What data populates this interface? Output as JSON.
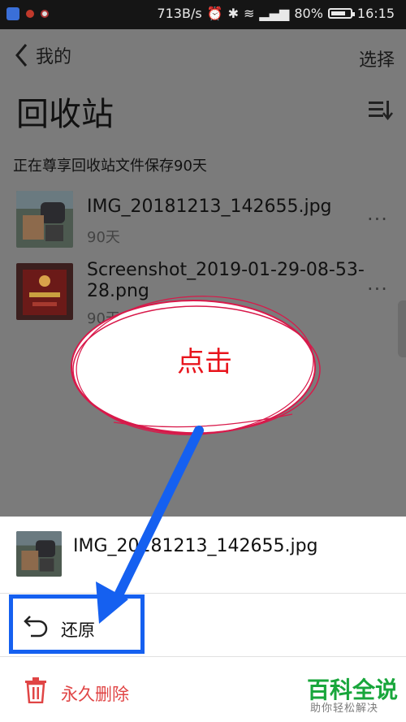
{
  "status_bar": {
    "speed": "713B/s",
    "battery": "80%",
    "battery_level": 0.8,
    "time": "16:15"
  },
  "header": {
    "back_label": "我的",
    "select_label": "选择"
  },
  "page": {
    "title": "回收站",
    "subtitle": "正在尊享回收站文件保存90天"
  },
  "files": [
    {
      "name": "IMG_20181213_142655.jpg",
      "meta": "90天",
      "more": "···"
    },
    {
      "name": "Screenshot_2019-01-29-08-53-",
      "name_line2": "28.png",
      "meta": "90天",
      "more": "···"
    }
  ],
  "annotation": {
    "click_label": "点击",
    "ellipse_color": "#d8194a",
    "box_color": "#1560f0"
  },
  "sheet": {
    "file_name": "IMG_20181213_142655.jpg",
    "restore_label": "还原",
    "delete_label": "永久删除",
    "delete_color": "#e04545"
  },
  "watermark": {
    "title": "百科全说",
    "subtitle": "助你轻松解决"
  },
  "icons": [
    "chevron-left-icon",
    "sort-icon",
    "more-icon",
    "undo-icon",
    "trash-icon"
  ]
}
